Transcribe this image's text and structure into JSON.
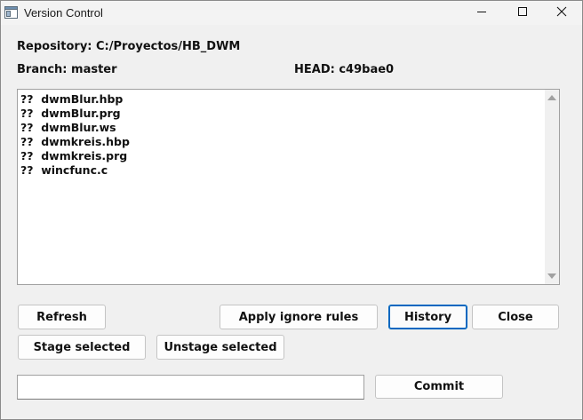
{
  "window": {
    "title": "Version Control",
    "app_icon": "window-app-icon"
  },
  "titlebar_buttons": {
    "minimize_icon": "minimize-icon",
    "maximize_icon": "maximize-icon",
    "close_icon": "close-icon"
  },
  "info": {
    "repository": "Repository: C:/Proyectos/HB_DWM",
    "branch": "Branch: master",
    "head": "HEAD: c49bae0"
  },
  "files": [
    "??  dwmBlur.hbp",
    "??  dwmBlur.prg",
    "??  dwmBlur.ws",
    "??  dwmkreis.hbp",
    "??  dwmkreis.prg",
    "??  wincfunc.c"
  ],
  "buttons": {
    "refresh": "Refresh",
    "apply_ignore_rules": "Apply ignore rules",
    "history": "History",
    "close": "Close",
    "stage_selected": "Stage selected",
    "unstage_selected": "Unstage selected",
    "commit": "Commit"
  },
  "commit_message": {
    "value": "",
    "placeholder": ""
  },
  "colors": {
    "focus_accent": "#0067c0",
    "window_bg": "#f0f0f0"
  }
}
